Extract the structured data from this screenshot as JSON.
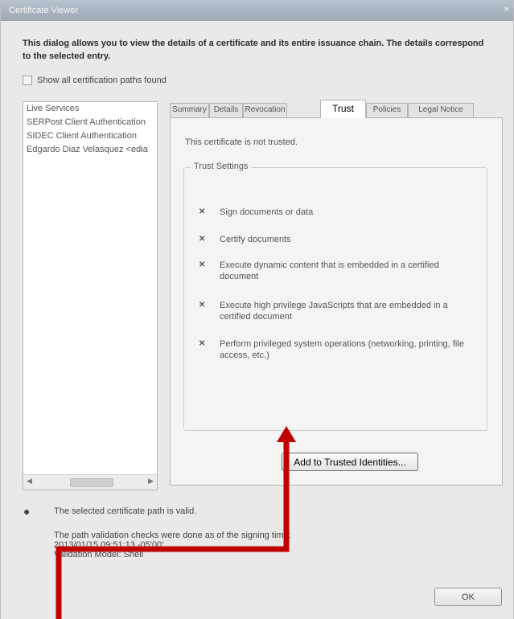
{
  "window": {
    "title": "Certificate Viewer",
    "close_label": "✕"
  },
  "intro": {
    "text": "This dialog allows you to view the details of a certificate and its entire issuance chain. The details correspond to the selected entry."
  },
  "show_all": {
    "label": "Show all certification paths found"
  },
  "tree": {
    "items": [
      "Live Services",
      "SERPost Client Authentication",
      "SIDEC Client Authentication",
      "Edgardo Diaz Velasquez <edia"
    ]
  },
  "tabs": [
    {
      "label": "Summary"
    },
    {
      "label": "Details"
    },
    {
      "label": "Revocation"
    },
    {
      "label": "Trust"
    },
    {
      "label": "Policies"
    },
    {
      "label": "Legal Notice"
    }
  ],
  "trust": {
    "status": "This certificate is not trusted.",
    "settings_legend": "Trust Settings",
    "mark": "✕",
    "settings": [
      "Sign documents or data",
      "Certify documents",
      "Execute dynamic content that is embedded in a certified document",
      "Execute high privilege JavaScripts that are embedded in a certified document",
      "Perform privileged system operations (networking, printing, file access, etc.)"
    ],
    "add_button": "Add to Trusted Identities..."
  },
  "footer": {
    "status_icon": "●",
    "status_text": "The selected certificate path is valid.",
    "details_line1": "The path validation checks were done as of the signing time:",
    "details_line2": "2013/01/15 09:51:13 -05'00'",
    "details_line3": "Validation Model: Shell",
    "ok_label": "OK"
  },
  "annotation": {
    "color": "#c00000"
  }
}
